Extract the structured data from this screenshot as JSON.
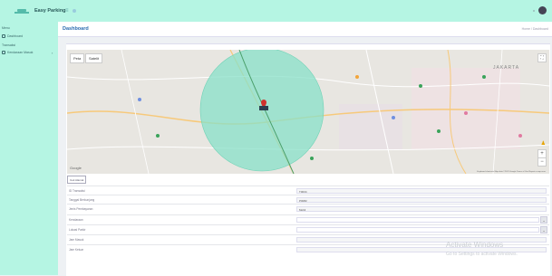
{
  "app": {
    "brand": "Easy Parking",
    "burger_icon": "menu-icon",
    "accent": "#b5f5e3",
    "title_color": "#2b6cb0"
  },
  "sidebar": {
    "section_main": "Menu",
    "dashboard": "Dashboard",
    "section_tx": "Transaksi",
    "parking": "Kendaraan Masuk"
  },
  "header": {
    "title": "Dashboard",
    "breadcrumb": "Home / Dashboard"
  },
  "map": {
    "tab_map": "Peta",
    "tab_satellite": "Satelit",
    "google": "Google",
    "attribution": "Keyboard shortcuts   Map data ©2021 Google   Terms of Use   Report a map error",
    "fullscreen_icon": "fullscreen-icon",
    "zoom_in": "+",
    "zoom_out": "−",
    "labels": {
      "jakarta": "JAKARTA"
    },
    "circle_color": "#88e0c8",
    "marker_color": "#d0312d"
  },
  "small_button": "Cek Alamat",
  "form": [
    {
      "label": "ID Transaksi",
      "value": "T0034",
      "kind": "input"
    },
    {
      "label": "Tanggal Berkunjung",
      "value": "P0082",
      "kind": "input"
    },
    {
      "label": "Jenis Pembayaran",
      "value": "Mobil",
      "kind": "input"
    },
    {
      "label": "Kendaraan",
      "value": "",
      "kind": "select"
    },
    {
      "label": "Lokasi Parkir",
      "value": "",
      "kind": "select"
    },
    {
      "label": "Jam Masuk",
      "value": "",
      "kind": "input"
    },
    {
      "label": "Jam Keluar",
      "value": "",
      "kind": "input"
    }
  ],
  "watermark": {
    "line1": "Activate Windows",
    "line2": "Go to Settings to activate Windows."
  }
}
